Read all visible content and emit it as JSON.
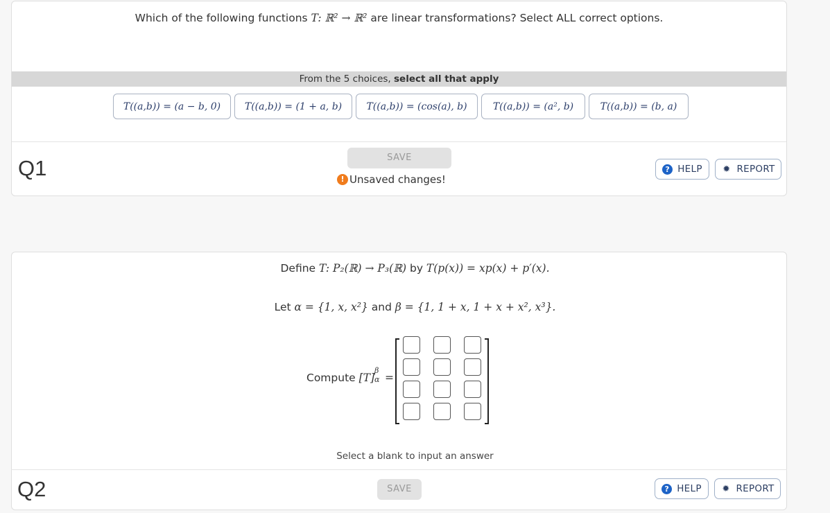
{
  "q1": {
    "prompt_prefix": "Which of the following functions ",
    "prompt_math": "T: ℝ² → ℝ²",
    "prompt_suffix": " are linear transformations? Select ALL correct options.",
    "choice_bar_prefix": "From the 5 choices, ",
    "choice_bar_bold": "select all that apply",
    "choices": [
      "T((a,b)) = (a − b, 0)",
      "T((a,b)) = (1 + a, b)",
      "T((a,b)) = (cos(a), b)",
      "T((a,b)) = (a², b)",
      "T((a,b)) = (b, a)"
    ],
    "label": "Q1",
    "save_label": "SAVE",
    "unsaved_icon": "!",
    "unsaved_text": "Unsaved changes!",
    "help_label": "HELP",
    "report_label": "REPORT"
  },
  "q2": {
    "line1_prefix": "Define ",
    "line1_math1": "T: P₂(ℝ) → P₃(ℝ)",
    "line1_mid": " by ",
    "line1_math2": "T(p(x)) = xp(x) + p′(x).",
    "line2_prefix": "Let ",
    "line2_math1": "α = {1, x, x²}",
    "line2_mid": " and ",
    "line2_math2": "β = {1, 1 + x, 1 + x + x², x³}.",
    "compute_prefix": "Compute ",
    "compute_math": "[T]",
    "compute_sup": "β",
    "compute_sub": "α",
    "compute_eq": " =",
    "matrix_rows": 4,
    "matrix_cols": 3,
    "hint": "Select a blank to input an answer",
    "label": "Q2",
    "save_label": "SAVE",
    "help_label": "HELP",
    "report_label": "REPORT"
  },
  "icons": {
    "help": "question-circle-icon",
    "report": "bug-icon",
    "warning": "exclamation-circle-icon"
  },
  "colors": {
    "help_icon": "#1d63c7",
    "warning_icon": "#f07c1d",
    "choice_bar": "#d7d7d7"
  }
}
